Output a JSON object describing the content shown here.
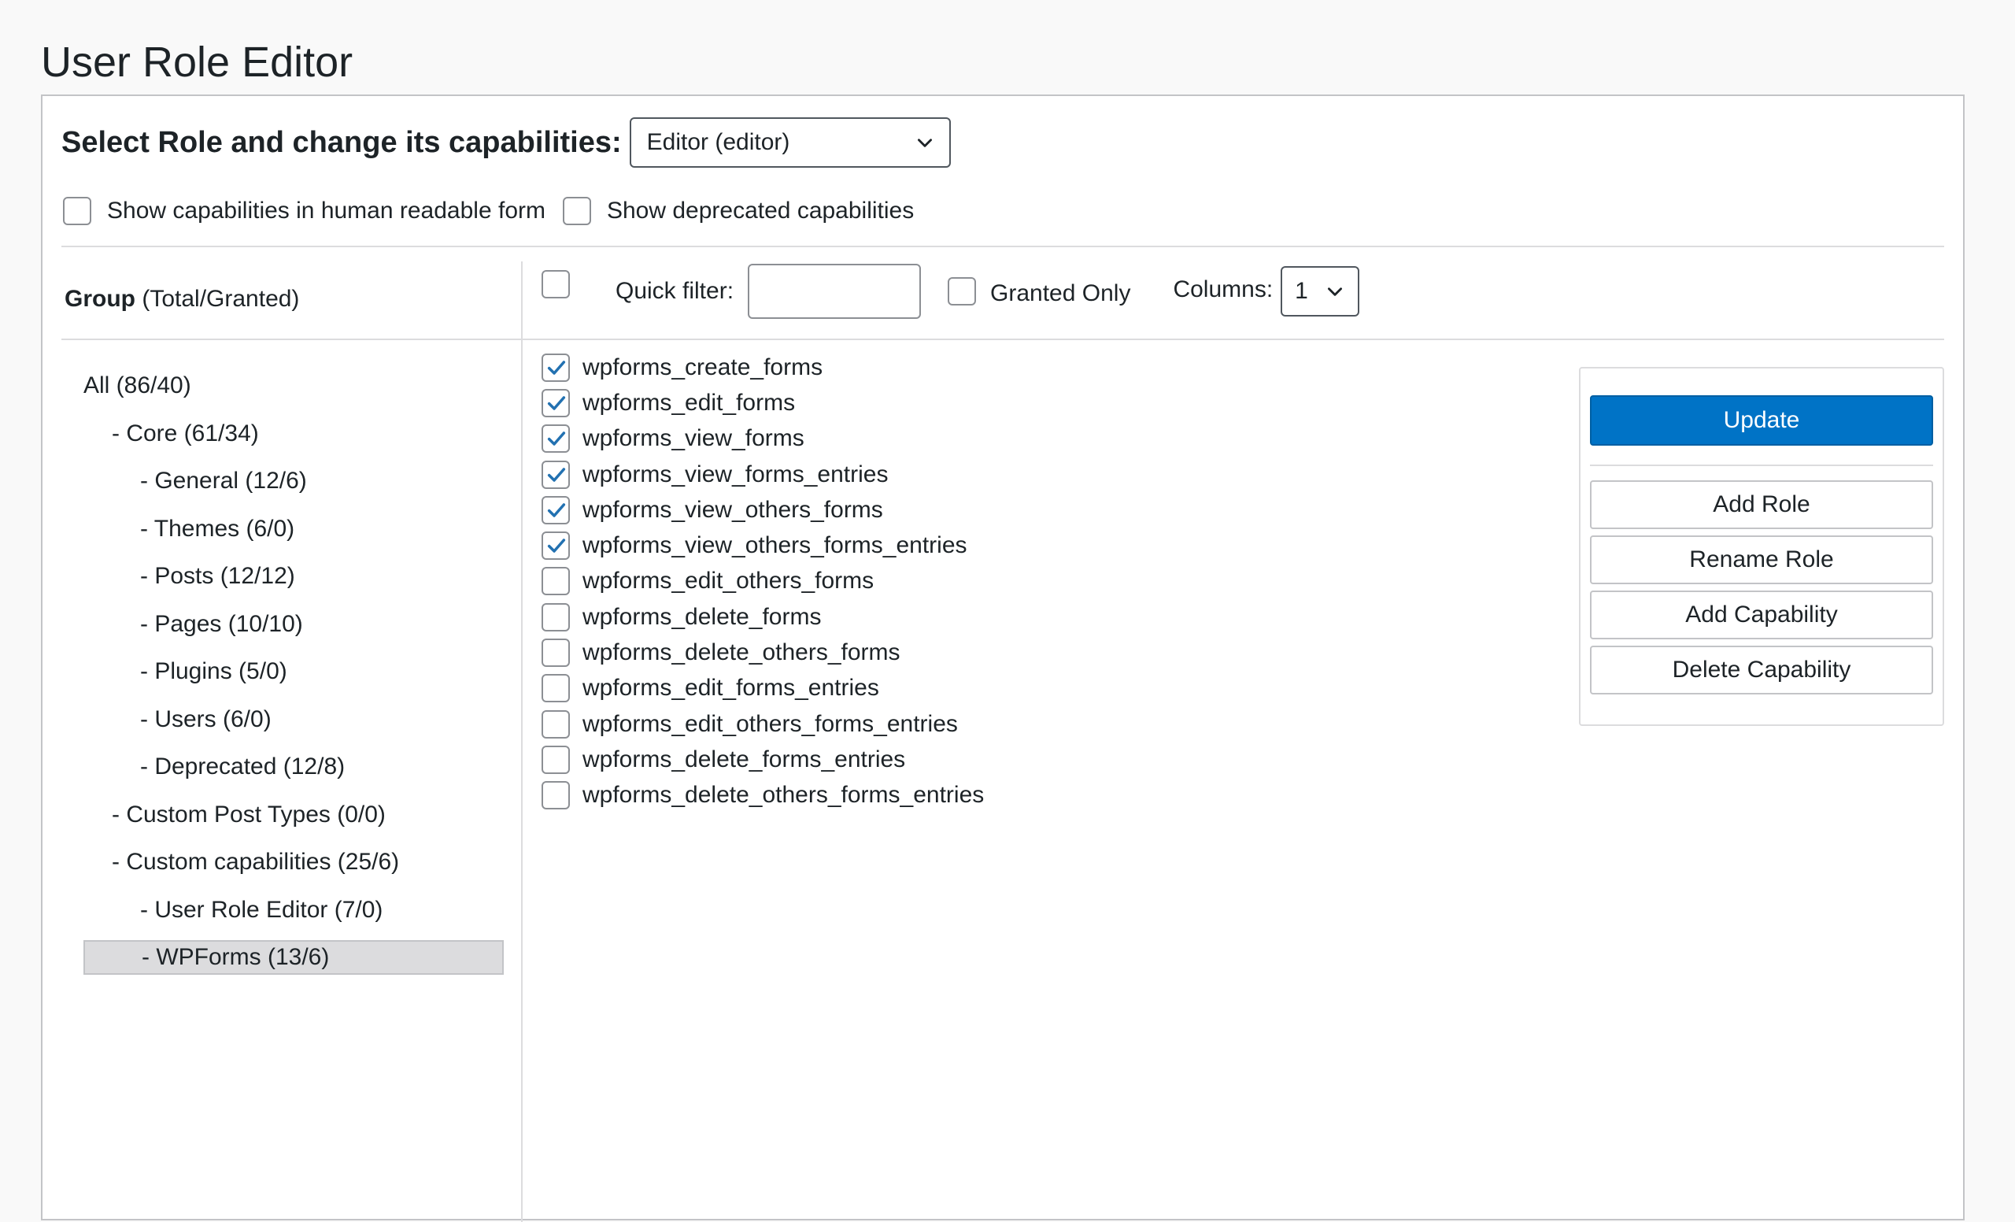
{
  "page": {
    "title": "User Role Editor"
  },
  "role": {
    "label": "Select Role and change its capabilities:",
    "selected": "Editor (editor)"
  },
  "options": {
    "human_readable": "Show capabilities in human readable form",
    "deprecated": "Show deprecated capabilities"
  },
  "groups": {
    "header_bold": "Group",
    "header_rest": "(Total/Granted)",
    "items": [
      {
        "label": "All (86/40)",
        "level": 0,
        "selected": false
      },
      {
        "label": "- Core (61/34)",
        "level": 1,
        "selected": false
      },
      {
        "label": "- General (12/6)",
        "level": 2,
        "selected": false
      },
      {
        "label": "- Themes (6/0)",
        "level": 2,
        "selected": false
      },
      {
        "label": "- Posts (12/12)",
        "level": 2,
        "selected": false
      },
      {
        "label": "- Pages (10/10)",
        "level": 2,
        "selected": false
      },
      {
        "label": "- Plugins (5/0)",
        "level": 2,
        "selected": false
      },
      {
        "label": "- Users (6/0)",
        "level": 2,
        "selected": false
      },
      {
        "label": "- Deprecated (12/8)",
        "level": 2,
        "selected": false
      },
      {
        "label": "- Custom Post Types (0/0)",
        "level": 1,
        "selected": false
      },
      {
        "label": "- Custom capabilities (25/6)",
        "level": 1,
        "selected": false
      },
      {
        "label": "- User Role Editor (7/0)",
        "level": 2,
        "selected": false
      },
      {
        "label": "- WPForms (13/6)",
        "level": 2,
        "selected": true
      }
    ]
  },
  "toolbar": {
    "quick_filter_label": "Quick filter:",
    "quick_filter_value": "",
    "granted_only_label": "Granted Only",
    "columns_label": "Columns:",
    "columns_value": "1"
  },
  "capabilities": [
    {
      "name": "wpforms_create_forms",
      "checked": true
    },
    {
      "name": "wpforms_edit_forms",
      "checked": true
    },
    {
      "name": "wpforms_view_forms",
      "checked": true
    },
    {
      "name": "wpforms_view_forms_entries",
      "checked": true
    },
    {
      "name": "wpforms_view_others_forms",
      "checked": true
    },
    {
      "name": "wpforms_view_others_forms_entries",
      "checked": true
    },
    {
      "name": "wpforms_edit_others_forms",
      "checked": false
    },
    {
      "name": "wpforms_delete_forms",
      "checked": false
    },
    {
      "name": "wpforms_delete_others_forms",
      "checked": false
    },
    {
      "name": "wpforms_edit_forms_entries",
      "checked": false
    },
    {
      "name": "wpforms_edit_others_forms_entries",
      "checked": false
    },
    {
      "name": "wpforms_delete_forms_entries",
      "checked": false
    },
    {
      "name": "wpforms_delete_others_forms_entries",
      "checked": false
    }
  ],
  "actions": {
    "update": "Update",
    "add_role": "Add Role",
    "rename_role": "Rename Role",
    "add_capability": "Add Capability",
    "delete_capability": "Delete Capability"
  },
  "colors": {
    "accent": "#0073c6",
    "check": "#2271b1"
  }
}
